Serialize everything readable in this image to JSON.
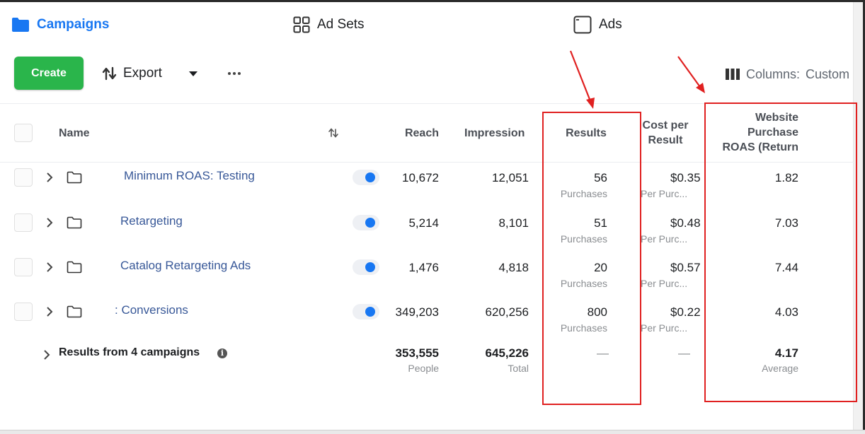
{
  "tabs": {
    "campaigns": "Campaigns",
    "adsets": "Ad Sets",
    "ads": "Ads"
  },
  "toolbar": {
    "create_label": "Create",
    "export_label": "Export",
    "columns_label": "Columns:",
    "columns_value": "Custom"
  },
  "table": {
    "headers": {
      "name": "Name",
      "reach": "Reach",
      "impressions": "Impression",
      "results": "Results",
      "cost_per_result_1": "Cost per",
      "cost_per_result_2": "Result",
      "roas_1": "Website",
      "roas_2": "Purchase",
      "roas_3": "ROAS (Return"
    },
    "rows": [
      {
        "name": "Minimum ROAS: Testing",
        "reach": "10,672",
        "impressions": "12,051",
        "results": "56",
        "results_unit": "Purchases",
        "cost": "$0.35",
        "cost_unit": "Per Purc...",
        "roas": "1.82"
      },
      {
        "name": "Retargeting",
        "reach": "5,214",
        "impressions": "8,101",
        "results": "51",
        "results_unit": "Purchases",
        "cost": "$0.48",
        "cost_unit": "Per Purc...",
        "roas": "7.03"
      },
      {
        "name": "Catalog Retargeting Ads",
        "reach": "1,476",
        "impressions": "4,818",
        "results": "20",
        "results_unit": "Purchases",
        "cost": "$0.57",
        "cost_unit": "Per Purc...",
        "roas": "7.44"
      },
      {
        "name": ": Conversions",
        "reach": "349,203",
        "impressions": "620,256",
        "results": "800",
        "results_unit": "Purchases",
        "cost": "$0.22",
        "cost_unit": "Per Purc...",
        "roas": "4.03"
      }
    ],
    "totals": {
      "label": "Results from 4 campaigns",
      "reach": "353,555",
      "reach_unit": "People",
      "impressions": "645,226",
      "impressions_unit": "Total",
      "results": "—",
      "cost": "—",
      "roas": "4.17",
      "roas_unit": "Average"
    }
  },
  "colors": {
    "accent": "#1877f2",
    "create_button": "#2ab54b",
    "annotation": "#e02020"
  },
  "icons": [
    "folder-icon",
    "grid-icon",
    "ad-icon",
    "export-icon",
    "caret-down-icon",
    "more-icon",
    "columns-icon",
    "sort-icon",
    "chevron-right-icon",
    "info-icon"
  ]
}
